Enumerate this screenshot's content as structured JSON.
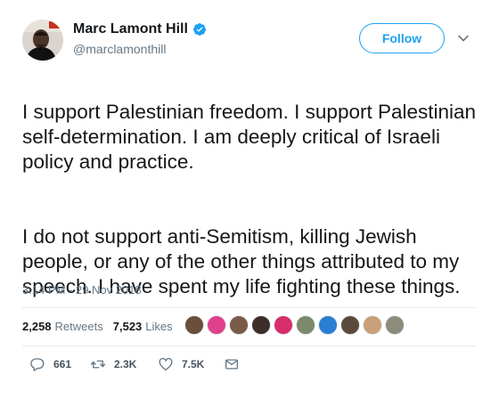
{
  "user": {
    "display_name": "Marc Lamont Hill",
    "handle": "@marclamonthill",
    "verified": true
  },
  "follow_label": "Follow",
  "tweet_paragraphs": [
    "I support Palestinian freedom. I support Palestinian self-determination. I am deeply critical of Israeli policy and practice.",
    "I do not support anti-Semitism, killing Jewish people, or any of the other things attributed to my speech. I have spent my life fighting these things."
  ],
  "timestamp": "3:14 PM - 29 Nov 2018",
  "stats": {
    "retweets_count": "2,258",
    "retweets_label": "Retweets",
    "likes_count": "7,523",
    "likes_label": "Likes"
  },
  "liker_avatar_colors": [
    "#6b4f3a",
    "#e0418c",
    "#7a5c48",
    "#3c2f2a",
    "#d62e6a",
    "#7b8a6a",
    "#2a7fd4",
    "#5b4a3c",
    "#c9a07a",
    "#8d8c7a"
  ],
  "actions": {
    "reply_count": "661",
    "retweet_count": "2.3K",
    "like_count": "7.5K"
  },
  "colors": {
    "accent": "#1da1f2",
    "secondary_text": "#657786"
  }
}
